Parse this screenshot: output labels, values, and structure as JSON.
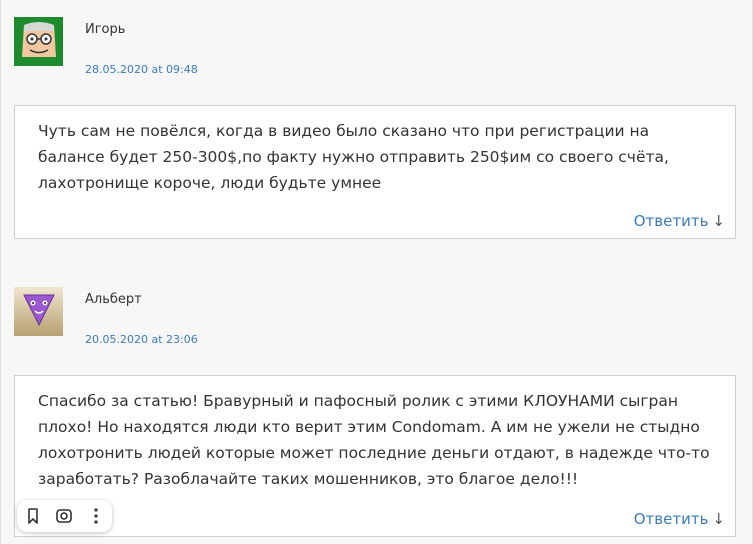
{
  "comments": [
    {
      "author": "Игорь",
      "date": "28.05.2020 at 09:48",
      "avatar_icon": "green-nerd-avatar-icon",
      "text": "Чуть сам не повёлся, когда в видео было сказано что при регистрации на балансе будет 250-300$,по факту нужно отправить 250$им со своего счёта, лахотронище короче, люди будьте умнее",
      "reply_label": "Ответить",
      "reply_arrow": "↓"
    },
    {
      "author": "Альберт",
      "date": "20.05.2020 at 23:06",
      "avatar_icon": "purple-triangle-avatar-icon",
      "text": "Спасибо за статью! Бравурный и пафосный ролик с этими КЛОУНАМИ сыгран плохо! Но находятся люди кто верит этим Condomam. А им не ужели не стыдно лохотронить людей которые может последние деньги отдают, в надежде что-то заработать? Разоблачайте таких мошенников, это благое дело!!!",
      "reply_label": "Ответить",
      "reply_arrow": "↓"
    }
  ],
  "toolbar": {
    "icons": [
      "bookmark-icon",
      "lens-search-icon",
      "more-vertical-icon"
    ]
  },
  "colors": {
    "link": "#3a7bbf",
    "box_border": "#cfcfcf",
    "background": "#f7f7f7"
  }
}
